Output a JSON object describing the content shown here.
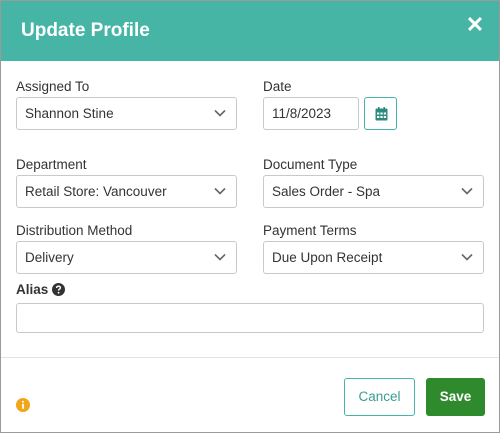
{
  "dialog": {
    "title": "Update Profile",
    "accent_color": "#47b5a6",
    "save_color": "#2f8a2d"
  },
  "form": {
    "assigned_to": {
      "label": "Assigned To",
      "value": "Shannon Stine"
    },
    "date": {
      "label": "Date",
      "value": "11/8/2023"
    },
    "department": {
      "label": "Department",
      "value": "Retail Store: Vancouver"
    },
    "document_type": {
      "label": "Document Type",
      "value": "Sales Order - Spa"
    },
    "distribution_method": {
      "label": "Distribution Method",
      "value": "Delivery"
    },
    "payment_terms": {
      "label": "Payment Terms",
      "value": "Due Upon Receipt"
    },
    "alias": {
      "label": "Alias",
      "value": ""
    }
  },
  "footer": {
    "cancel_label": "Cancel",
    "save_label": "Save"
  },
  "icons": [
    "close-icon",
    "calendar-icon",
    "chevron-down-icon",
    "help-icon",
    "info-icon"
  ]
}
